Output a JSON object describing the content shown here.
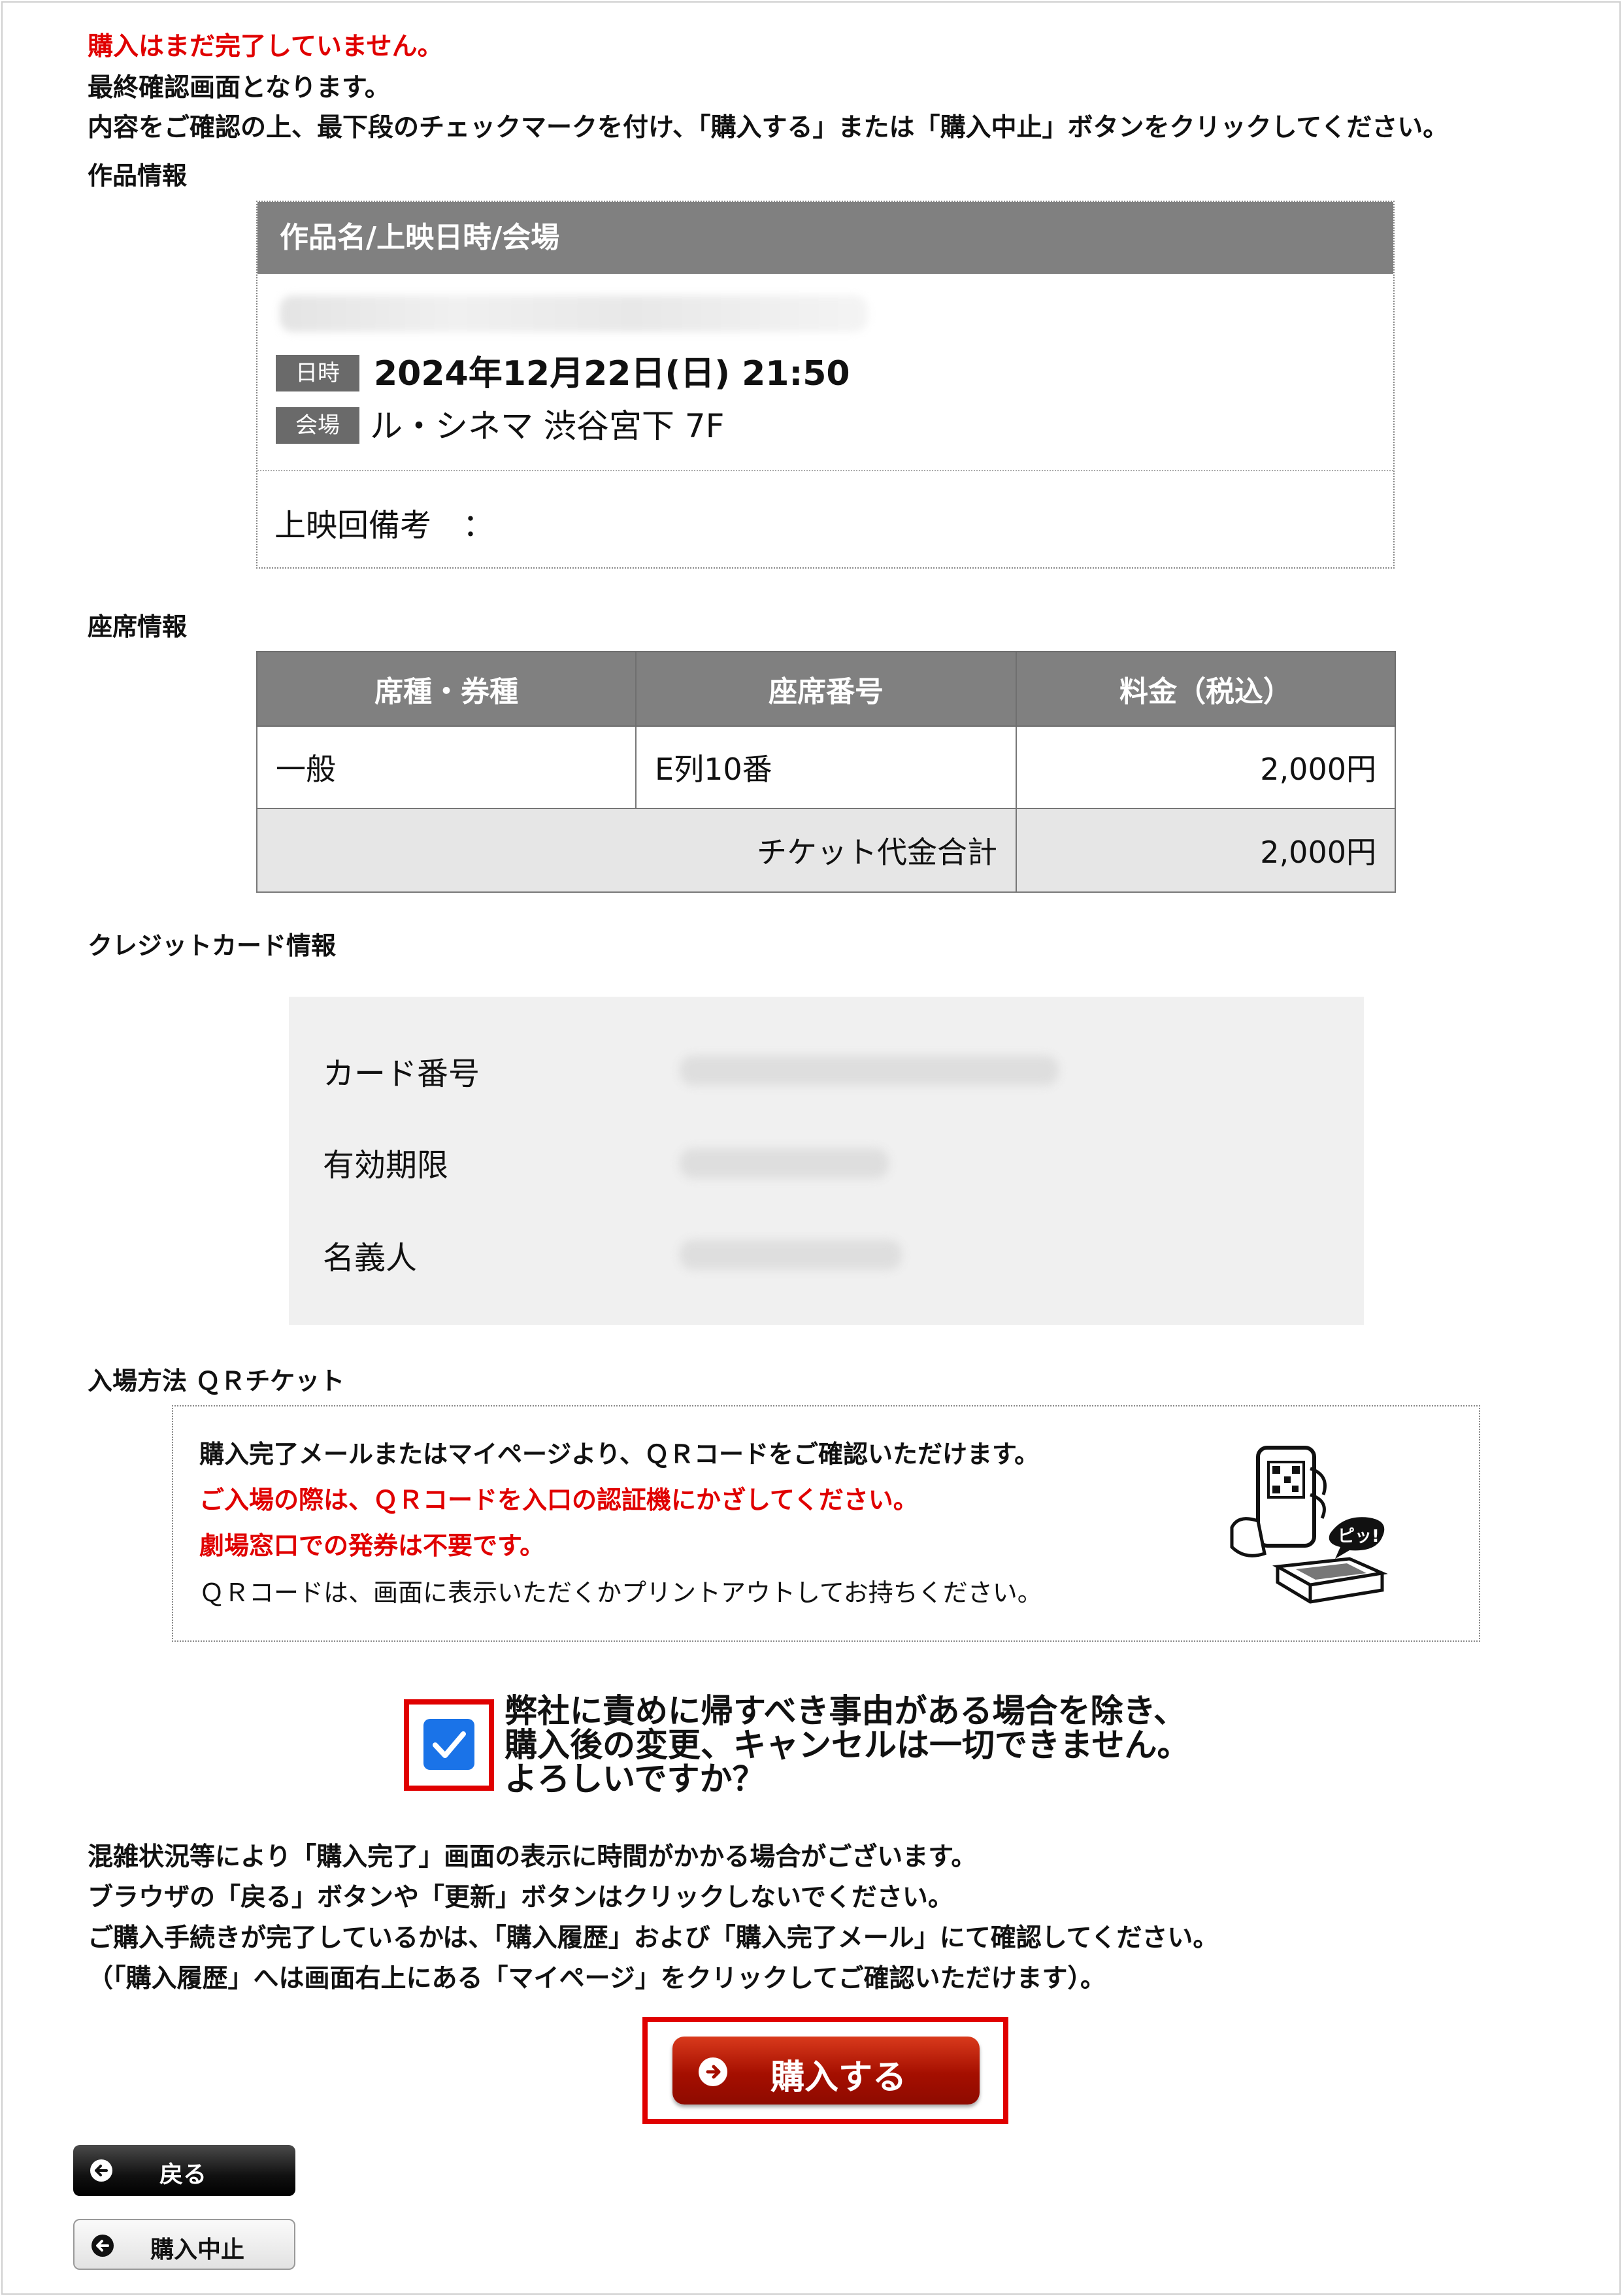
{
  "notice": {
    "not_complete": "購入はまだ完了していません。",
    "final_confirm": "最終確認画面となります。",
    "instruction": "内容をご確認の上、最下段のチェックマークを付け、「購入する」または「購入中止」ボタンをクリックしてください。"
  },
  "work_info": {
    "heading": "作品情報",
    "table_header": "作品名/上映日時/会場",
    "date_badge": "日時",
    "date_value": "2024年12月22日(日) 21:50",
    "venue_badge": "会場",
    "venue_value": "ル・シネマ 渋谷宮下 7F",
    "remark_label": "上映回備考　："
  },
  "seat_info": {
    "heading": "座席情報",
    "columns": [
      "席種・券種",
      "座席番号",
      "料金（税込）"
    ],
    "rows": [
      {
        "type": "一般",
        "seat": "E列10番",
        "price": "2,000円"
      }
    ],
    "total_label": "チケット代金合計",
    "total_value": "2,000円"
  },
  "card_info": {
    "heading": "クレジットカード情報",
    "number_label": "カード番号",
    "expiry_label": "有効期限",
    "holder_label": "名義人"
  },
  "entry_method": {
    "heading": "入場方法 ＱＲチケット",
    "line1": "購入完了メールまたはマイページより、ＱＲコードをご確認いただけます。",
    "line2": "ご入場の際は、ＱＲコードを入口の認証機にかざしてください。",
    "line3": "劇場窓口での発券は不要です。",
    "line4": "ＱＲコードは、画面に表示いただくかプリントアウトしてお持ちください。",
    "bubble_text": "ピッ!"
  },
  "confirm": {
    "checked": true,
    "line1": "弊社に責めに帰すべき事由がある場合を除き、",
    "line2": "購入後の変更、キャンセルは一切できません。",
    "line3": "よろしいですか？"
  },
  "notes": {
    "line1": "混雑状況等により「購入完了」画面の表示に時間がかかる場合がございます。",
    "line2": "ブラウザの「戻る」ボタンや「更新」ボタンはクリックしないでください。",
    "line3": "ご購入手続きが完了しているかは、「購入履歴」および「購入完了メール」にて確認してください。",
    "line4": "（「購入履歴」へは画面右上にある「マイページ」をクリックしてご確認いただけます）。"
  },
  "buttons": {
    "buy": "購入する",
    "back": "戻る",
    "cancel": "購入中止"
  },
  "colors": {
    "warning_red": "#e00000",
    "header_gray": "#808080",
    "checkbox_blue": "#1a73e8",
    "buy_button": "#a50f00"
  }
}
